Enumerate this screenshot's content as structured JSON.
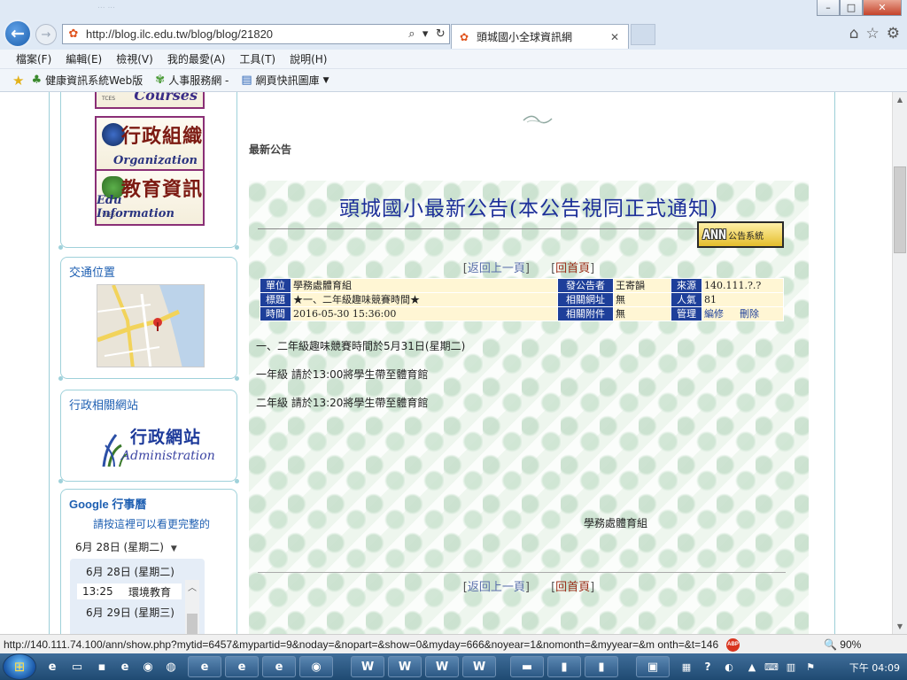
{
  "browser": {
    "faded_tab_text": "... ...",
    "url": "http://blog.ilc.edu.tw/blog/blog/21820",
    "tab_title": "頭城國小全球資訊網",
    "back_glyph": "←",
    "forward_glyph": "→",
    "window_controls": {
      "minimize": "–",
      "maximize": "□",
      "close": "✕"
    }
  },
  "menu": [
    "檔案(F)",
    "編輯(E)",
    "檢視(V)",
    "我的最愛(A)",
    "工具(T)",
    "說明(H)"
  ],
  "favorites": [
    "健康資訊系統Web版",
    "人事服務網 -",
    "網頁快訊圖庫"
  ],
  "sidebar": {
    "banners": [
      {
        "cn": "",
        "en": "Courses"
      },
      {
        "cn": "行政組織",
        "en": "Organization"
      },
      {
        "cn": "教育資訊",
        "en": "Edu Information"
      }
    ],
    "banner_school_tag": "TCES",
    "traffic_title": "交通位置",
    "admin_title": "行政相關網站",
    "admin_logo_cn": "行政網站",
    "admin_logo_en": "Administration",
    "google_title": "Google 行事曆",
    "google_link": "請按這裡可以看更完整的",
    "date_selected": "6月 28日 (星期二)",
    "calendar": {
      "day1": "6月 28日 (星期二)",
      "event_time": "13:25",
      "event_title": "環境教育",
      "day2": "6月 29日 (星期三)"
    }
  },
  "main": {
    "section_title": "最新公告",
    "bulletin_title": "頭城國小最新公告(本公告視同正式通知)",
    "ann_logo_letters": "ANN",
    "ann_logo_text": "公告系統",
    "back_link": "返回上一頁",
    "home_link": "回首頁",
    "bracket_open": "[",
    "bracket_close": "]",
    "info": {
      "unit_label": "單位",
      "unit": "學務處體育組",
      "poster_label": "發公告者",
      "poster": "王寄韻",
      "source_label": "來源",
      "source": "140.111.?.?",
      "subject_label": "標題",
      "subject": "★一、二年級趣味競賽時間★",
      "related_url_label": "相關網址",
      "related_url": "無",
      "views_label": "人氣",
      "views": "81",
      "time_label": "時間",
      "time": "2016-05-30 15:36:00",
      "attachment_label": "相關附件",
      "attachment": "無",
      "manage_label": "管理",
      "edit": "編修",
      "delete": "刪除"
    },
    "body_lines": [
      "一、二年級趣味競賽時間於5月31日(星期二)",
      "一年級 請於13:00將學生帶至體育館",
      "二年級 請於13:20將學生帶至體育館"
    ],
    "signature": "學務處體育組"
  },
  "status": {
    "url": "http://140.111.74.100/ann/show.php?mytid=6457&mypartid=9&noday=&nopart=&show=0&myday=666&noyear=1&nomonth=&myyear=&m        onth=&t=146",
    "abp_label": "ABP",
    "zoom": "🔍 90%"
  },
  "taskbar": {
    "time": "下午 04:09"
  }
}
